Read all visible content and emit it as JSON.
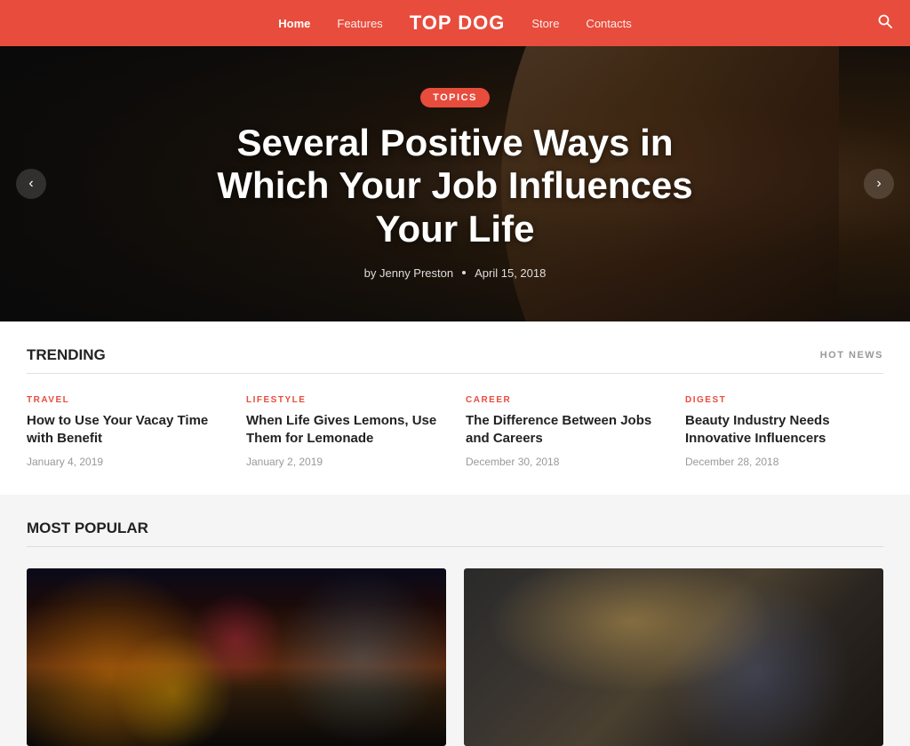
{
  "header": {
    "site_title": "TOP DOG",
    "nav": [
      {
        "label": "Home",
        "active": true
      },
      {
        "label": "Features",
        "active": false
      },
      {
        "label": "Store",
        "active": false
      },
      {
        "label": "Contacts",
        "active": false
      }
    ],
    "search_label": "search"
  },
  "hero": {
    "tag": "TOPICS",
    "title": "Several Positive Ways in Which Your Job Influences Your Life",
    "author": "by Jenny Preston",
    "date": "April 15, 2018",
    "prev_label": "‹",
    "next_label": "›"
  },
  "trending": {
    "title": "Trending",
    "badge": "HOT NEWS",
    "items": [
      {
        "category": "TRAVEL",
        "title": "How to Use Your Vacay Time with Benefit",
        "date": "January 4, 2019"
      },
      {
        "category": "LIFESTYLE",
        "title": "When Life Gives Lemons, Use Them for Lemonade",
        "date": "January 2, 2019"
      },
      {
        "category": "CAREER",
        "title": "The Difference Between Jobs and Careers",
        "date": "December 30, 2018"
      },
      {
        "category": "DIGEST",
        "title": "Beauty Industry Needs Innovative Influencers",
        "date": "December 28, 2018"
      }
    ]
  },
  "most_popular": {
    "title": "Most Popular",
    "cards": [
      {
        "alt": "City nightlife",
        "type": "city"
      },
      {
        "alt": "Office meeting",
        "type": "office"
      }
    ]
  }
}
